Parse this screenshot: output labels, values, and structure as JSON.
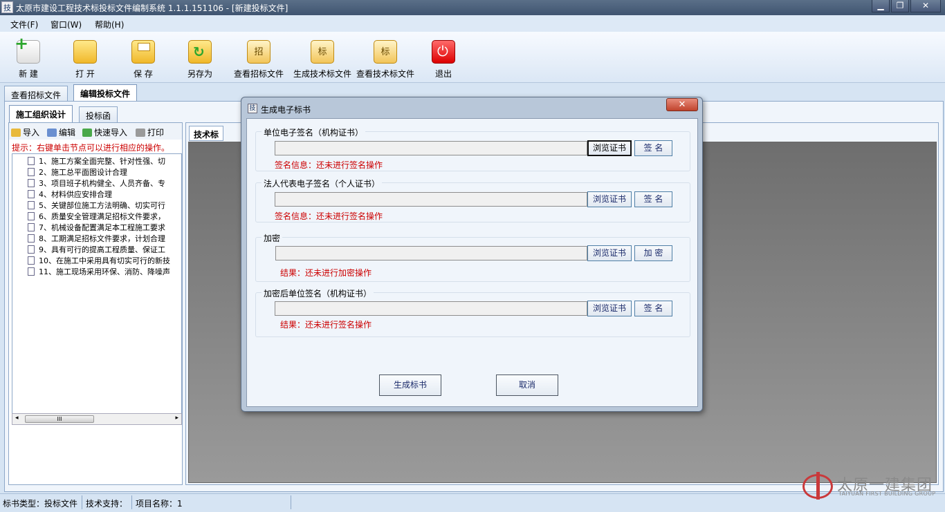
{
  "window": {
    "icon_text": "技",
    "title": "太原市建设工程技术标投标文件编制系统 1.1.1.151106 - [新建投标文件]",
    "minimize": "▁",
    "restore": "❐",
    "close": "✕"
  },
  "menu": [
    "文件(F)",
    "窗口(W)",
    "帮助(H)"
  ],
  "toolbar": {
    "new": "新 建",
    "open": "打 开",
    "save": "保 存",
    "saveas": "另存为",
    "view_tender": "查看招标文件",
    "view_tender_glyph": "招",
    "gen_tech": "生成技术标文件",
    "gen_tech_glyph": "标",
    "view_tech": "查看技术标文件",
    "view_tech_glyph": "标",
    "exit": "退出"
  },
  "tabs": [
    "查看招标文件",
    "编辑投标文件"
  ],
  "subtabs": [
    "施工组织设计",
    "投标函"
  ],
  "left": {
    "actions": [
      "导入",
      "编辑",
      "快速导入",
      "打印"
    ],
    "hint": "提示：右键单击节点可以进行相应的操作。",
    "tree": [
      "1、施工方案全面完整、针对性强、切",
      "2、施工总平面图设计合理",
      "3、项目班子机构健全、人员齐备、专",
      "4、材料供应安排合理",
      "5、关键部位施工方法明确、切实可行",
      "6、质量安全管理满足招标文件要求，",
      "7、机械设备配置满足本工程施工要求",
      "8、工期满足招标文件要求，计划合理",
      "9、具有可行的提高工程质量、保证工",
      "10、在施工中采用具有切实可行的新技",
      "11、施工现场采用环保、消防、降噪声"
    ],
    "scroll_thumb": "III",
    "scroll_left": "◂",
    "scroll_right": "▸"
  },
  "right": {
    "tab": "技术标"
  },
  "status": {
    "book_type": "标书类型：投标文件",
    "support": "技术支持：",
    "project": "项目名称：1"
  },
  "logo": {
    "cn": "太原一建集团",
    "en": "TAIYUAN FIRST BUILDING GROUP"
  },
  "dialog": {
    "icon_text": "技",
    "title": "生成电子标书",
    "close": "✕",
    "groups": [
      {
        "title": "单位电子签名（机构证书）",
        "browse": "浏览证书",
        "action": "签 名",
        "info": "签名信息：还未进行签名操作",
        "value": ""
      },
      {
        "title": "法人代表电子签名（个人证书）",
        "browse": "浏览证书",
        "action": "签 名",
        "info": "签名信息：还未进行签名操作",
        "value": ""
      },
      {
        "title": "加密",
        "browse": "浏览证书",
        "action": "加 密",
        "info": "结果：还未进行加密操作",
        "value": ""
      },
      {
        "title": "加密后单位签名（机构证书）",
        "browse": "浏览证书",
        "action": "签 名",
        "info": "结果：还未进行签名操作",
        "value": ""
      }
    ],
    "generate": "生成标书",
    "cancel": "取消"
  }
}
